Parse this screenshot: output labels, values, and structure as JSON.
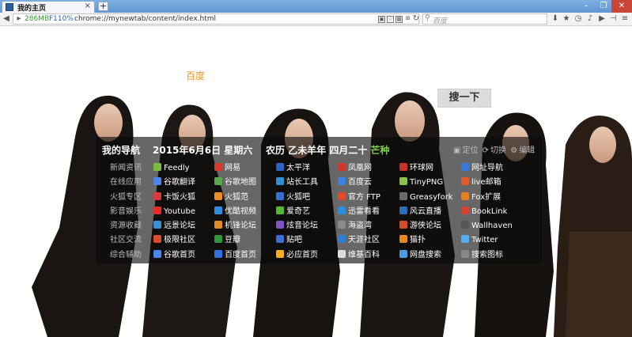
{
  "browser": {
    "tab_title": "我的主页",
    "tab_close": "×",
    "new_tab": "+",
    "memory": "286MB",
    "zoom": "F110%",
    "url": "chrome://mynewtab/content/index.html",
    "search_placeholder": "百度",
    "win_min": "–",
    "win_max": "❐",
    "win_close": "✕"
  },
  "page": {
    "baidu_label": "百度",
    "search_button": "搜一下"
  },
  "nav": {
    "heading": "我的导航",
    "date": "2015年6月6日 星期六",
    "lunar": "农历 乙未羊年 四月二十",
    "solar_term": "芒种",
    "tools": [
      "定位",
      "切换",
      "编辑"
    ],
    "categories": [
      "新闻资讯",
      "在线应用",
      "火狐专区",
      "影音娱乐",
      "资源收藏",
      "社区交流",
      "综合辅助"
    ],
    "rows": [
      [
        {
          "label": "Feedly",
          "icon": "feedly-icon",
          "color": "#7dbb3a"
        },
        {
          "label": "网易",
          "icon": "netease-icon",
          "color": "#d23b2d"
        },
        {
          "label": "太平洋",
          "icon": "pconline-icon",
          "color": "#2b63c6"
        },
        {
          "label": "凤凰网",
          "icon": "ifeng-icon",
          "color": "#d5382b"
        },
        {
          "label": "环球网",
          "icon": "huanqiu-icon",
          "color": "#c8302a"
        },
        {
          "label": "网址导航",
          "icon": "hao-icon",
          "color": "#3778d8"
        }
      ],
      [
        {
          "label": "谷歌翻译",
          "icon": "google-translate-icon",
          "color": "#4a86e8"
        },
        {
          "label": "谷歌地图",
          "icon": "google-maps-icon",
          "color": "#59a84b"
        },
        {
          "label": "站长工具",
          "icon": "chinaz-icon",
          "color": "#2e8fd3"
        },
        {
          "label": "百度云",
          "icon": "baidu-cloud-icon",
          "color": "#3b82e0"
        },
        {
          "label": "TinyPNG",
          "icon": "tinypng-icon",
          "color": "#8bbf4b"
        },
        {
          "label": "live邮箱",
          "icon": "outlook-icon",
          "color": "#e45b2a"
        }
      ],
      [
        {
          "label": "卡饭火狐",
          "icon": "kafan-icon",
          "color": "#d83b3b"
        },
        {
          "label": "火狐范",
          "icon": "firefoxfan-icon",
          "color": "#f08a24"
        },
        {
          "label": "火狐吧",
          "icon": "tieba-icon",
          "color": "#3a6fd4"
        },
        {
          "label": "官方 FTP",
          "icon": "mozilla-ftp-icon",
          "color": "#e54a2b"
        },
        {
          "label": "Greasyfork",
          "icon": "greasyfork-icon",
          "color": "#6b6b6b"
        },
        {
          "label": "Fox扩展",
          "icon": "fox-extension-icon",
          "color": "#e67e22"
        }
      ],
      [
        {
          "label": "Youtube",
          "icon": "youtube-icon",
          "color": "#e52d27"
        },
        {
          "label": "优酷视频",
          "icon": "youku-icon",
          "color": "#2f8ce0"
        },
        {
          "label": "爱奇艺",
          "icon": "iqiyi-icon",
          "color": "#59b72e"
        },
        {
          "label": "迅雷看看",
          "icon": "xunlei-icon",
          "color": "#2b8fe0"
        },
        {
          "label": "风云直播",
          "icon": "fengyun-icon",
          "color": "#2c6fb8"
        },
        {
          "label": "BookLink",
          "icon": "booklink-icon",
          "color": "#d8402f"
        }
      ],
      [
        {
          "label": "远景论坛",
          "icon": "pcbeta-icon",
          "color": "#3a8fd6"
        },
        {
          "label": "机锋论坛",
          "icon": "gfan-icon",
          "color": "#e28b22"
        },
        {
          "label": "炫音论坛",
          "icon": "xuanyin-icon",
          "color": "#7e53c2"
        },
        {
          "label": "海盗湾",
          "icon": "piratebay-icon",
          "color": "#8a8a8a"
        },
        {
          "label": "游侠论坛",
          "icon": "ali213-icon",
          "color": "#d64a2b"
        },
        {
          "label": "Wallhaven",
          "icon": "wallhaven-icon",
          "color": "#555555"
        }
      ],
      [
        {
          "label": "极限社区",
          "icon": "jixian-icon",
          "color": "#d94b2b"
        },
        {
          "label": "豆瓣",
          "icon": "douban-icon",
          "color": "#2f963a"
        },
        {
          "label": "贴吧",
          "icon": "tieba2-icon",
          "color": "#3a6fd4"
        },
        {
          "label": "天涯社区",
          "icon": "tianya-icon",
          "color": "#2d7dd2"
        },
        {
          "label": "猫扑",
          "icon": "mop-icon",
          "color": "#e68a1f"
        },
        {
          "label": "Twitter",
          "icon": "twitter-icon",
          "color": "#55acee"
        }
      ],
      [
        {
          "label": "谷歌首页",
          "icon": "google-icon",
          "color": "#4a86e8"
        },
        {
          "label": "百度首页",
          "icon": "baidu-icon",
          "color": "#2f6fe0"
        },
        {
          "label": "必应首页",
          "icon": "bing-icon",
          "color": "#f2b01e"
        },
        {
          "label": "维基百科",
          "icon": "wikipedia-icon",
          "color": "#dddddd"
        },
        {
          "label": "网盘搜索",
          "icon": "pan-search-icon",
          "color": "#4d9be0"
        },
        {
          "label": "搜索图标",
          "icon": "search-icon-tool",
          "color": "#888888"
        }
      ]
    ]
  }
}
